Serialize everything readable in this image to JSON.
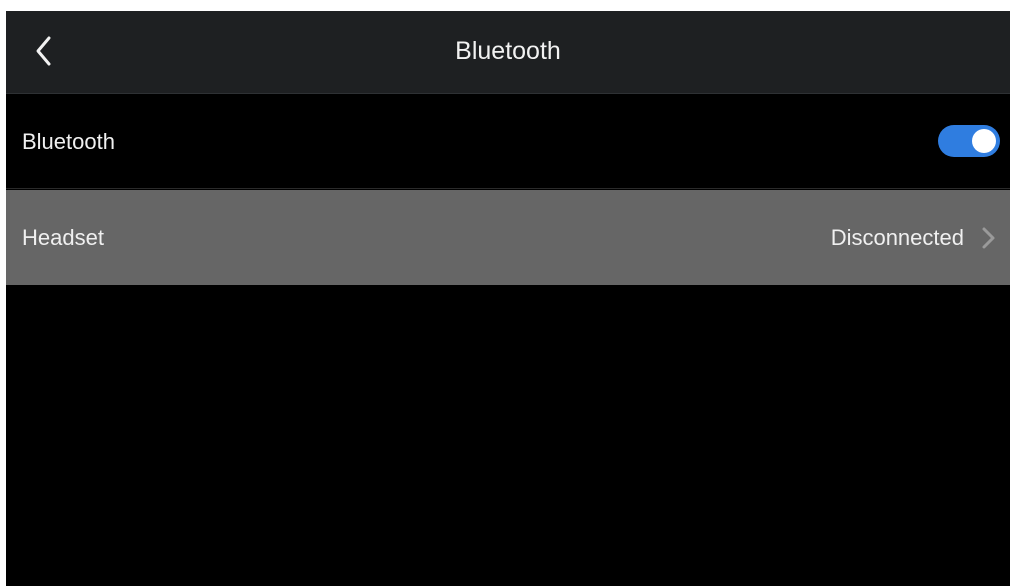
{
  "header": {
    "title": "Bluetooth",
    "back_icon": "chevron-left-icon"
  },
  "settings": {
    "bluetooth": {
      "label": "Bluetooth",
      "enabled": true,
      "toggle_color": "#2f7de0"
    },
    "headset": {
      "label": "Headset",
      "status": "Disconnected",
      "chevron_icon": "chevron-right-icon"
    }
  },
  "colors": {
    "background": "#000000",
    "header_background": "#1e2022",
    "selected_row": "#666666",
    "text": "#f0f0f0"
  }
}
